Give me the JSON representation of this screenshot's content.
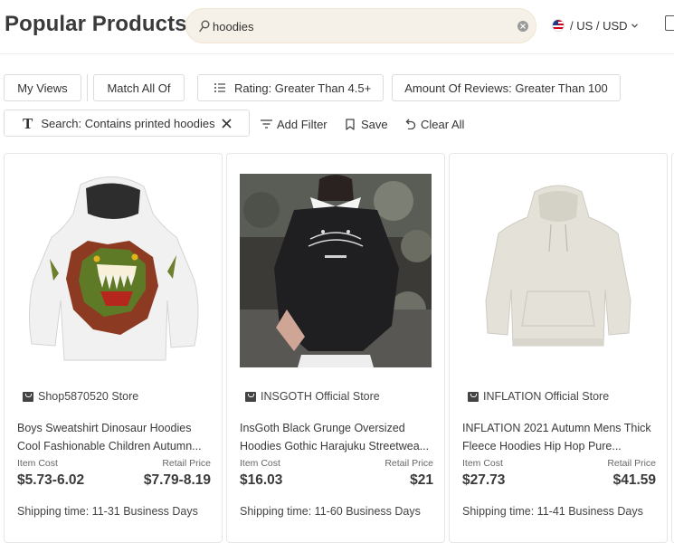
{
  "header": {
    "title": "Popular Products",
    "search_value": "hoodies",
    "region_label": "/ US / USD"
  },
  "filters": {
    "my_views": "My Views",
    "match_all": "Match All Of",
    "rating": "Rating: Greater Than 4.5+",
    "reviews": "Amount Of Reviews: Greater Than 100",
    "search_chip": "Search: Contains printed hoodies"
  },
  "actions": {
    "add_filter": "Add Filter",
    "save": "Save",
    "clear_all": "Clear All"
  },
  "products": [
    {
      "store": "Shop5870520 Store",
      "title_line1": "Boys Sweatshirt Dinosaur Hoodies",
      "title_line2": "Cool Fashionable Children Autumn...",
      "item_cost_label": "Item Cost",
      "item_cost": "$5.73-6.02",
      "retail_price_label": "Retail Price",
      "retail_price": "$7.79-8.19",
      "shipping": "Shipping time: 11-31 Business Days"
    },
    {
      "store": "INSGOTH Official Store",
      "title_line1": "InsGoth Black Grunge Oversized",
      "title_line2": "Hoodies Gothic Harajuku Streetwea...",
      "item_cost_label": "Item Cost",
      "item_cost": "$16.03",
      "retail_price_label": "Retail Price",
      "retail_price": "$21",
      "shipping": "Shipping time: 11-60 Business Days"
    },
    {
      "store": "INFLATION Official Store",
      "title_line1": "INFLATION 2021 Autumn Mens Thick",
      "title_line2": "Fleece Hoodies Hip Hop Pure...",
      "item_cost_label": "Item Cost",
      "item_cost": "$27.73",
      "retail_price_label": "Retail Price",
      "retail_price": "$41.59",
      "shipping": "Shipping time: 11-41 Business Days"
    }
  ],
  "colors": {
    "search_bg": "#f6f1e8",
    "text_primary": "#3a3a3a",
    "border": "#dcdcdc"
  }
}
